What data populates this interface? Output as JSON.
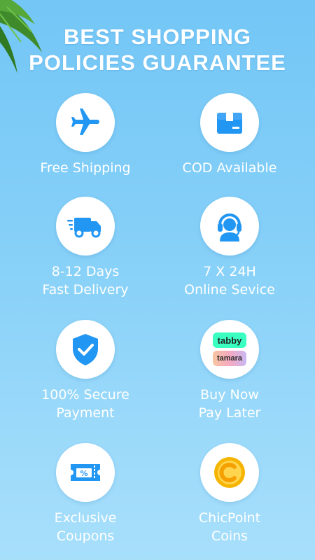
{
  "header": {
    "title_line1": "BEST SHOPPING",
    "title_line2": "POLICIES GUARANTEE"
  },
  "colors": {
    "icon_blue": "#2196f3",
    "background_top": "#73c6f6",
    "background_bottom": "#a7dffb"
  },
  "policies": [
    {
      "icon": "airplane-icon",
      "line1": "Free Shipping",
      "line2": ""
    },
    {
      "icon": "package-box-icon",
      "line1": "COD Available",
      "line2": ""
    },
    {
      "icon": "delivery-truck-icon",
      "line1": "8-12 Days",
      "line2": "Fast Delivery"
    },
    {
      "icon": "customer-service-headset-icon",
      "line1": "7 X 24H",
      "line2": "Online Sevice"
    },
    {
      "icon": "shield-check-icon",
      "line1": "100% Secure",
      "line2": "Payment"
    },
    {
      "icon": "tabby-tamara-logos",
      "line1": "Buy Now",
      "line2": "Pay Later",
      "logo1": "tabby",
      "logo2": "tamara"
    },
    {
      "icon": "coupon-ticket-icon",
      "line1": "Exclusive",
      "line2": "Coupons"
    },
    {
      "icon": "coin-icon",
      "line1": "ChicPoint",
      "line2": "Coins"
    }
  ]
}
